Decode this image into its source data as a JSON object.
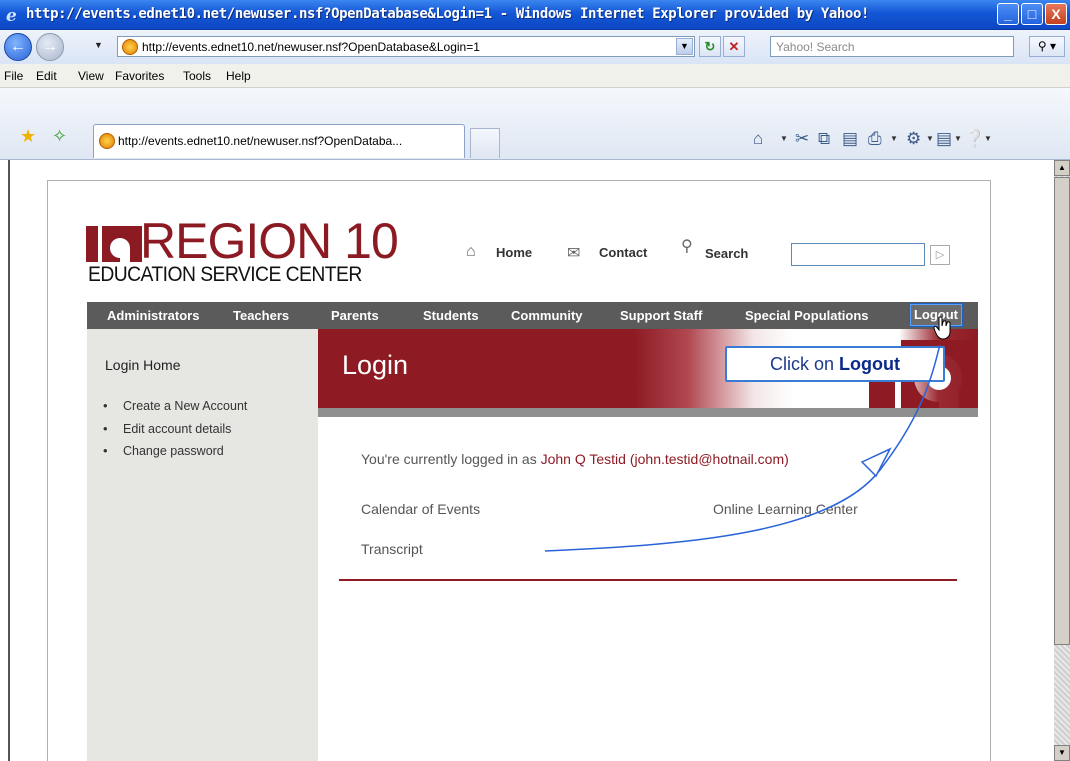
{
  "window": {
    "title": "http://events.ednet10.net/newuser.nsf?OpenDatabase&Login=1 - Windows Internet Explorer provided by Yahoo!",
    "url": "http://events.ednet10.net/newuser.nsf?OpenDatabase&Login=1",
    "search_placeholder": "Yahoo! Search",
    "tab_label": "http://events.ednet10.net/newuser.nsf?OpenDataba...",
    "min_label": "_",
    "max_label": "□",
    "close_label": "X"
  },
  "menu": [
    "File",
    "Edit",
    "View",
    "Favorites",
    "Tools",
    "Help"
  ],
  "site": {
    "logo_title": "REGION 10",
    "logo_subtitle": "EDUCATION SERVICE CENTER",
    "top_links": {
      "home": "Home",
      "contact": "Contact",
      "search": "Search"
    },
    "nav": [
      "Administrators",
      "Teachers",
      "Parents",
      "Students",
      "Community",
      "Support Staff",
      "Special Populations",
      "Logout"
    ],
    "sidebar": {
      "title": "Login Home",
      "items": [
        "Create a New Account",
        "Edit account details",
        "Change password"
      ]
    },
    "banner_title": "Login",
    "logged_in_prefix": "You're currently logged in as",
    "user": "John Q Testid (john.testid@hotnail.com)",
    "links": {
      "calendar": "Calendar of Events",
      "online": "Online Learning Center",
      "transcript": "Transcript"
    }
  },
  "callout": {
    "prefix": "Click on",
    "target": "Logout"
  },
  "colors": {
    "brand": "#8e1b24",
    "nav_bg": "#5b5b5b",
    "sidebar_bg": "#e6e6e3",
    "callout_border": "#3a7bd5"
  },
  "icons": [
    "ie-logo-icon",
    "back-icon",
    "forward-icon",
    "refresh-icon",
    "stop-icon",
    "search-icon",
    "favorites-star-icon",
    "add-favorites-icon",
    "home-icon",
    "feeds-icon",
    "print-icon",
    "page-icon",
    "tools-icon",
    "help-icon",
    "contact-mail-icon",
    "search-pin-icon",
    "hand-cursor-icon"
  ]
}
